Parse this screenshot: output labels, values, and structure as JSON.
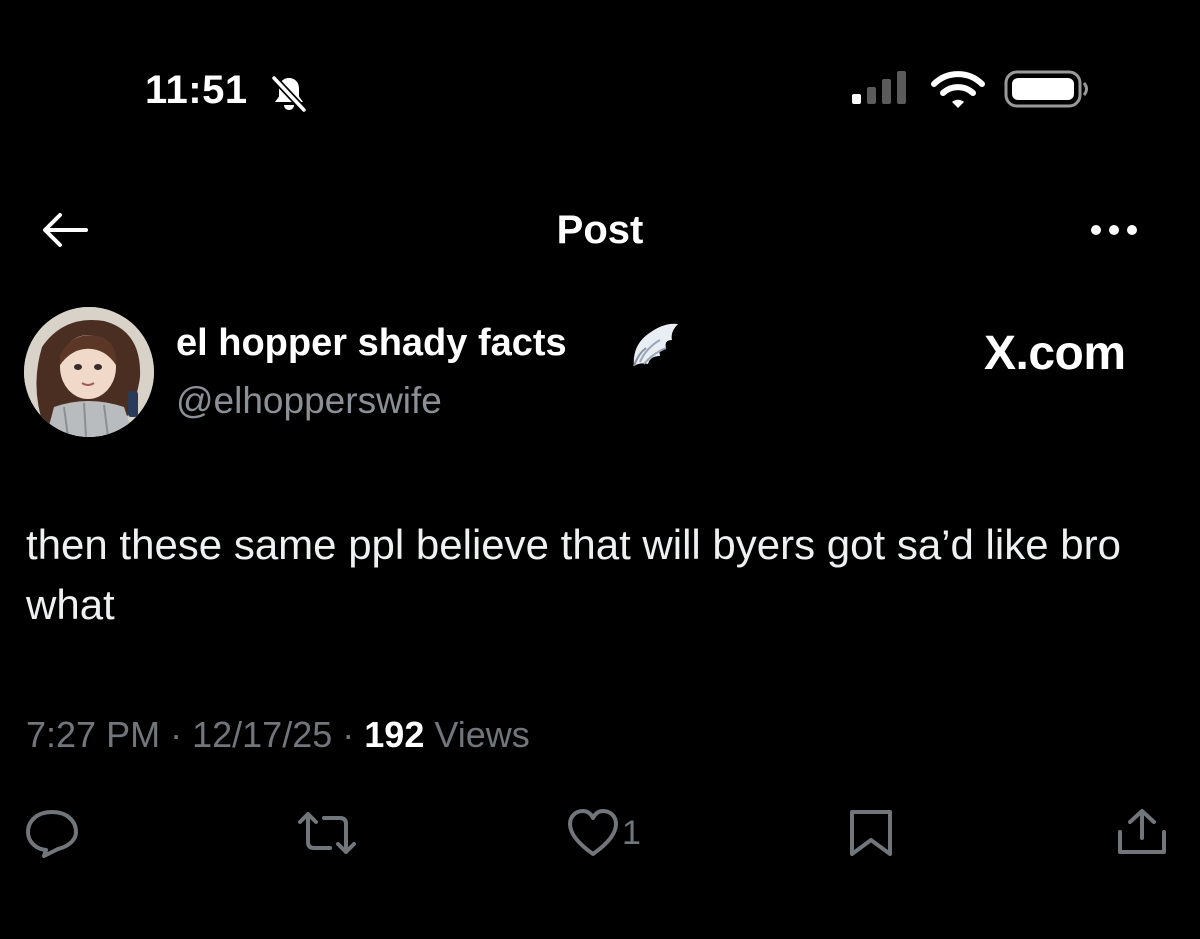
{
  "status_bar": {
    "time": "11:51"
  },
  "nav": {
    "title": "Post"
  },
  "post": {
    "author_name": "el hopper shady facts",
    "handle": "@elhopperswife",
    "watermark": "X.com",
    "text": "then these same ppl believe that will byers got sa’d like bro what",
    "time": "7:27 PM",
    "date": "12/17/25",
    "views_count": "192",
    "views_label": "Views",
    "separator": "·"
  },
  "actions": {
    "like_count": "1"
  },
  "colors": {
    "background": "#000000",
    "muted": "#71767b",
    "text": "#e7e9ea"
  },
  "icons": [
    "bell-slash-icon",
    "cellular-signal-icon",
    "wifi-icon",
    "battery-icon",
    "back-arrow-icon",
    "more-icon",
    "angel-wings-icon",
    "reply-icon",
    "retweet-icon",
    "like-icon",
    "bookmark-icon",
    "share-icon"
  ]
}
